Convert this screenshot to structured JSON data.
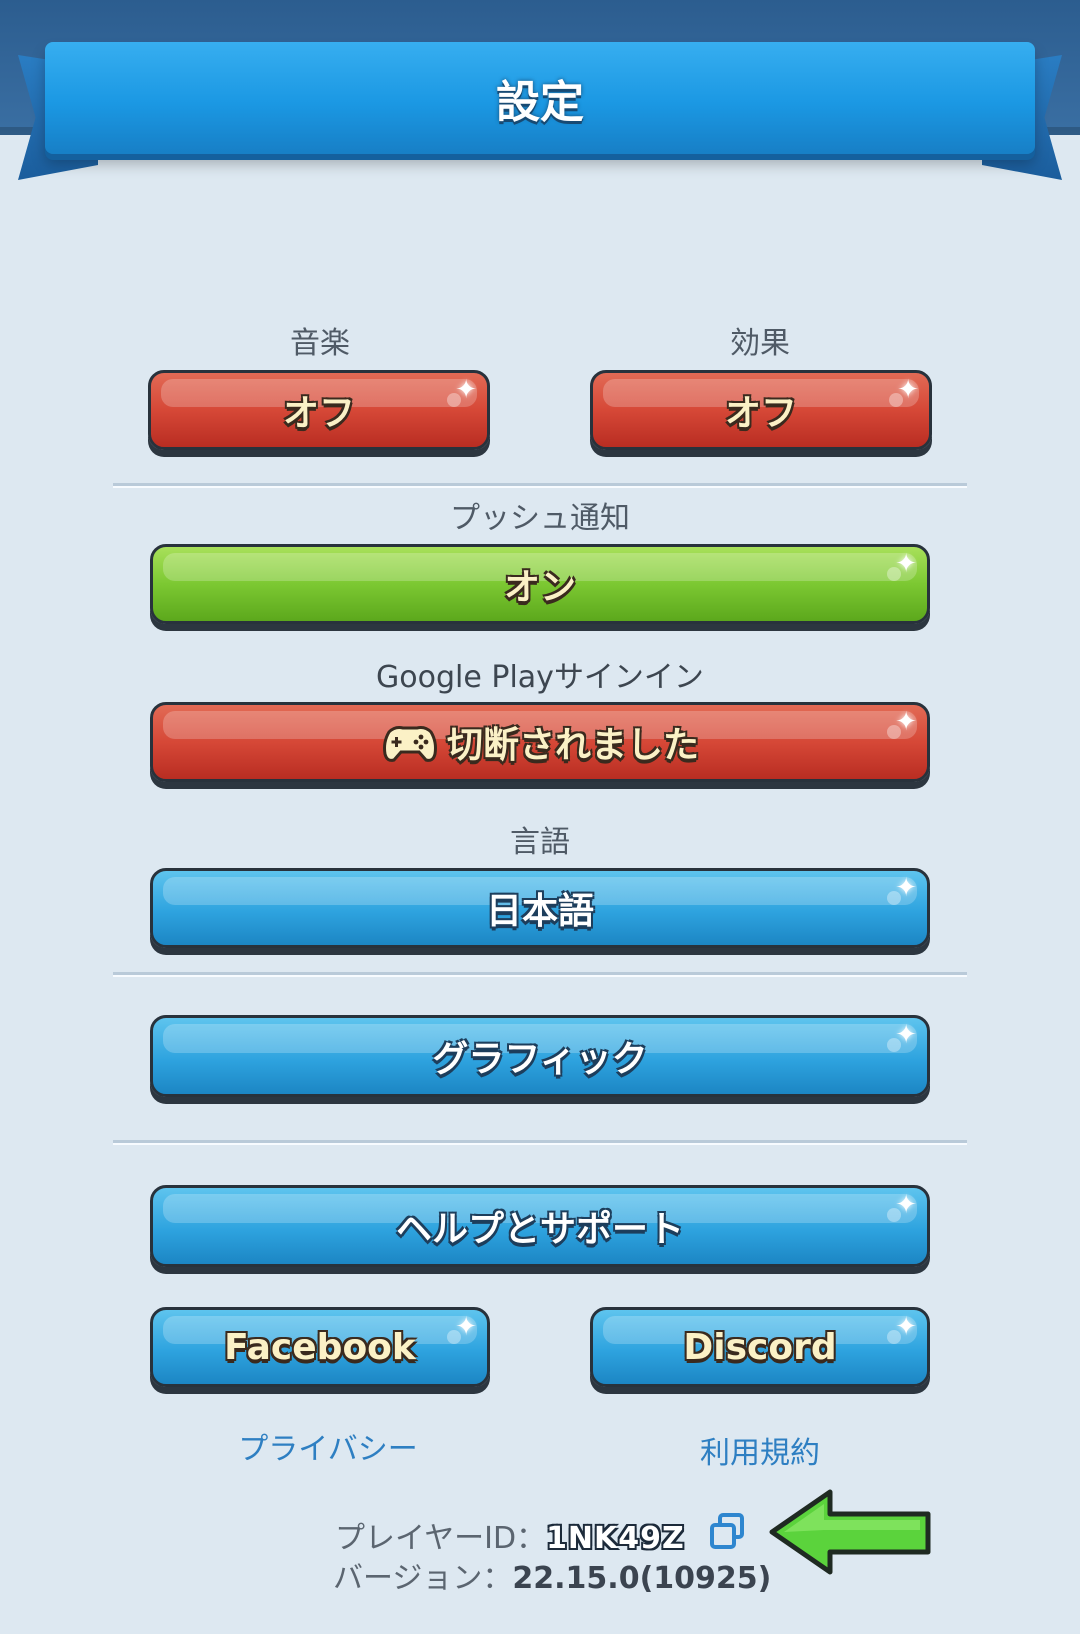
{
  "header": {
    "title": "設定"
  },
  "sound": {
    "music_label": "音楽",
    "music_value": "オフ",
    "effects_label": "効果",
    "effects_value": "オフ"
  },
  "push": {
    "label": "プッシュ通知",
    "value": "オン"
  },
  "google_play": {
    "label": "Google Playサインイン",
    "value": "切断されました",
    "icon": "gamepad-icon"
  },
  "language": {
    "label": "言語",
    "value": "日本語"
  },
  "graphics": {
    "label": "グラフィック"
  },
  "help": {
    "label": "ヘルプとサポート"
  },
  "social": {
    "facebook": "Facebook",
    "discord": "Discord"
  },
  "links": {
    "privacy": "プライバシー",
    "terms": "利用規約"
  },
  "footer": {
    "player_id_label": "プレイヤーID：",
    "player_id": "1NK49Z",
    "version_label": "バージョン：",
    "version": "22.15.0(10925)"
  },
  "colors": {
    "off_red": "#d64837",
    "on_green": "#7cc832",
    "button_blue": "#2ea3df",
    "ribbon_blue": "#1b98e3",
    "link_blue": "#2e7fc2",
    "arrow_green": "#5bd33c"
  }
}
